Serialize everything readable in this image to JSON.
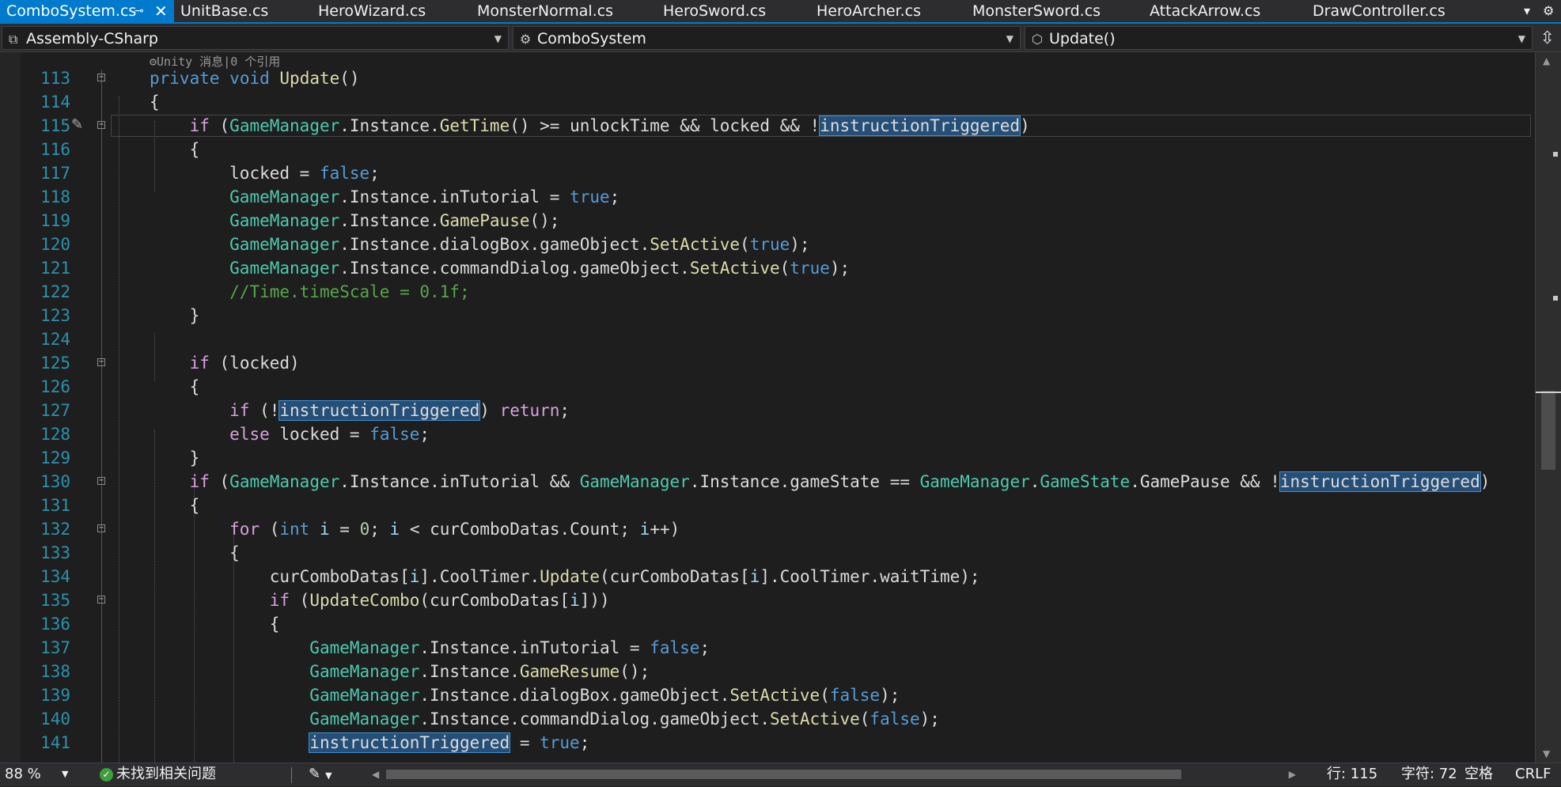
{
  "tabs": [
    {
      "label": "ComboSystem.cs",
      "active": true
    },
    {
      "label": "UnitBase.cs"
    },
    {
      "label": "HeroWizard.cs"
    },
    {
      "label": "MonsterNormal.cs"
    },
    {
      "label": "HeroSword.cs"
    },
    {
      "label": "HeroArcher.cs"
    },
    {
      "label": "MonsterSword.cs"
    },
    {
      "label": "AttackArrow.cs"
    },
    {
      "label": "DrawController.cs"
    }
  ],
  "nav": {
    "project": "Assembly-CSharp",
    "class": "ComboSystem",
    "member": "Update()"
  },
  "codelens": "⚙Unity 消息|0 个引用",
  "lines": [
    {
      "n": "113"
    },
    {
      "n": "114"
    },
    {
      "n": "115"
    },
    {
      "n": "116"
    },
    {
      "n": "117"
    },
    {
      "n": "118"
    },
    {
      "n": "119"
    },
    {
      "n": "120"
    },
    {
      "n": "121"
    },
    {
      "n": "122"
    },
    {
      "n": "123"
    },
    {
      "n": "124"
    },
    {
      "n": "125"
    },
    {
      "n": "126"
    },
    {
      "n": "127"
    },
    {
      "n": "128"
    },
    {
      "n": "129"
    },
    {
      "n": "130"
    },
    {
      "n": "131"
    },
    {
      "n": "132"
    },
    {
      "n": "133"
    },
    {
      "n": "134"
    },
    {
      "n": "135"
    },
    {
      "n": "136"
    },
    {
      "n": "137"
    },
    {
      "n": "138"
    },
    {
      "n": "139"
    },
    {
      "n": "140"
    },
    {
      "n": "141"
    }
  ],
  "tok": {
    "private": "private",
    "void": "void",
    "if": "if",
    "else": "else",
    "return": "return",
    "for": "for",
    "int": "int",
    "true": "true",
    "false": "false",
    "GameManager": "GameManager",
    "GameState": "GameState",
    "Instance": "Instance",
    "GetTime": "GetTime",
    "GamePause": "GamePause",
    "GameResume": "GameResume",
    "SetActive": "SetActive",
    "Update": "Update",
    "UpdateCombo": "UpdateCombo",
    "instructionTriggered": "instructionTriggered",
    "locked": "locked",
    "unlockTime": "unlockTime",
    "inTutorial": "inTutorial",
    "dialogBox": "dialogBox",
    "commandDialog": "commandDialog",
    "gameObject": "gameObject",
    "gameState": "gameState",
    "curComboDatas": "curComboDatas",
    "Count": "Count",
    "CoolTimer": "CoolTimer",
    "waitTime": "waitTime",
    "i": "i",
    "zero": "0",
    "comment122": "//Time.timeScale = 0.1f;"
  },
  "status": {
    "zoom": "88 %",
    "issues": "未找到相关问题",
    "row": "行: 115",
    "col": "字符: 72",
    "indent": "空格",
    "eol": "CRLF"
  }
}
